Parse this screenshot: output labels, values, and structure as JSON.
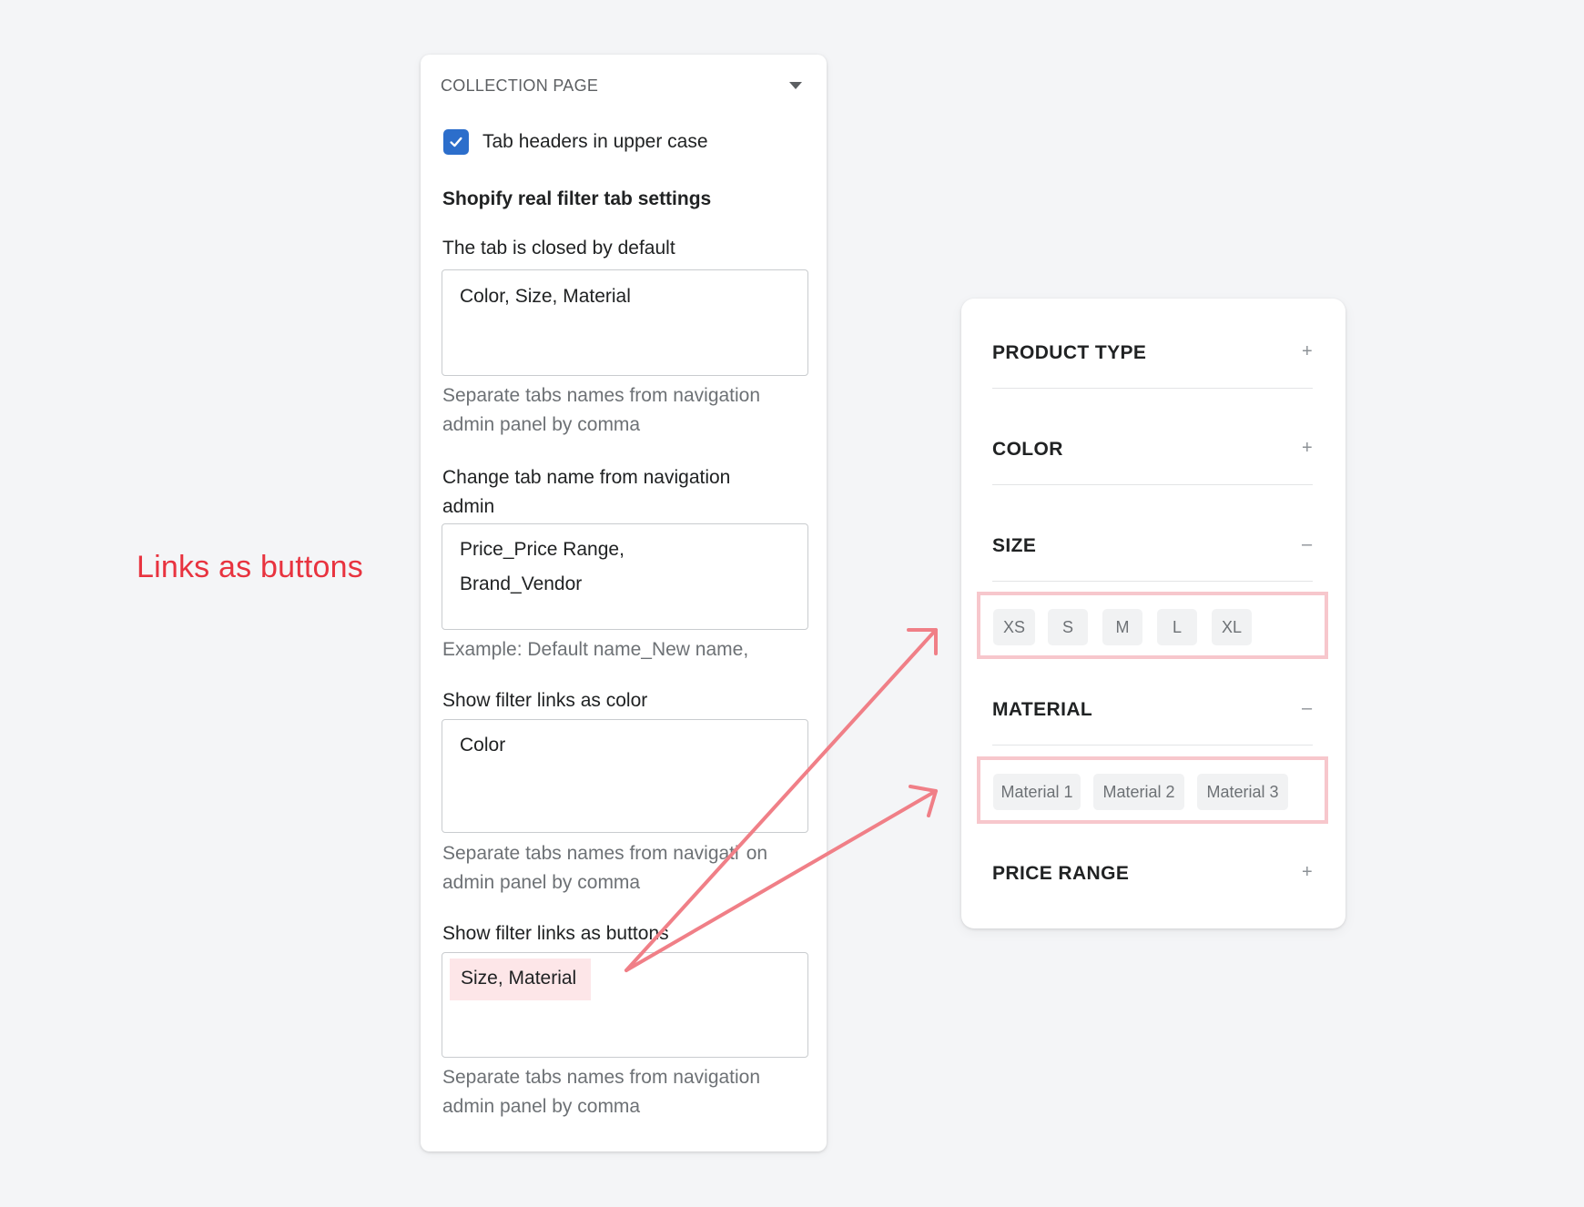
{
  "annotation": {
    "title": "Links as buttons"
  },
  "settings": {
    "title": "COLLECTION PAGE",
    "collapse_icon": "caret-down-icon",
    "checkbox": {
      "label": "Tab headers in upper case",
      "checked": true,
      "icon": "checkmark-icon"
    },
    "section_heading": "Shopify real filter tab settings",
    "closed_by_default": {
      "label": "The tab is closed by default",
      "value": "Color, Size, Material",
      "help_line1": "Separate tabs names from navigation",
      "help_line2": "admin panel by comma"
    },
    "change_tab_name": {
      "label_line1": "Change tab name from navigation",
      "label_line2": "admin",
      "value_line1": "Price_Price Range,",
      "value_line2": "Brand_Vendor",
      "help": "Example: Default name_New name,"
    },
    "links_as_color": {
      "label": "Show filter links as color",
      "value": "Color",
      "help_line1": "Separate tabs names from navigati",
      "help_line1_tail": "on",
      "help_line2": "admin panel by comma"
    },
    "links_as_buttons": {
      "label_start": "Show filter links as butt",
      "label_end": "ons",
      "value": "Size, Material",
      "help_line1": "Separate tabs names from navigation",
      "help_line2": "admin panel by comma"
    }
  },
  "preview": {
    "tabs": [
      {
        "name": "PRODUCT TYPE",
        "sign": "+"
      },
      {
        "name": "COLOR",
        "sign": "+"
      },
      {
        "name": "SIZE",
        "sign": "–"
      },
      {
        "name": "MATERIAL",
        "sign": "–"
      },
      {
        "name": "PRICE RANGE",
        "sign": "+"
      }
    ],
    "size_buttons": [
      "XS",
      "S",
      "M",
      "L",
      "XL"
    ],
    "material_buttons": [
      "Material 1",
      "Material 2",
      "Material 3"
    ]
  },
  "colors": {
    "accent": "#e8333f",
    "arrow": "#f07f87",
    "highlight_box": "#f7c7cc",
    "checkbox": "#2c6ecb"
  }
}
